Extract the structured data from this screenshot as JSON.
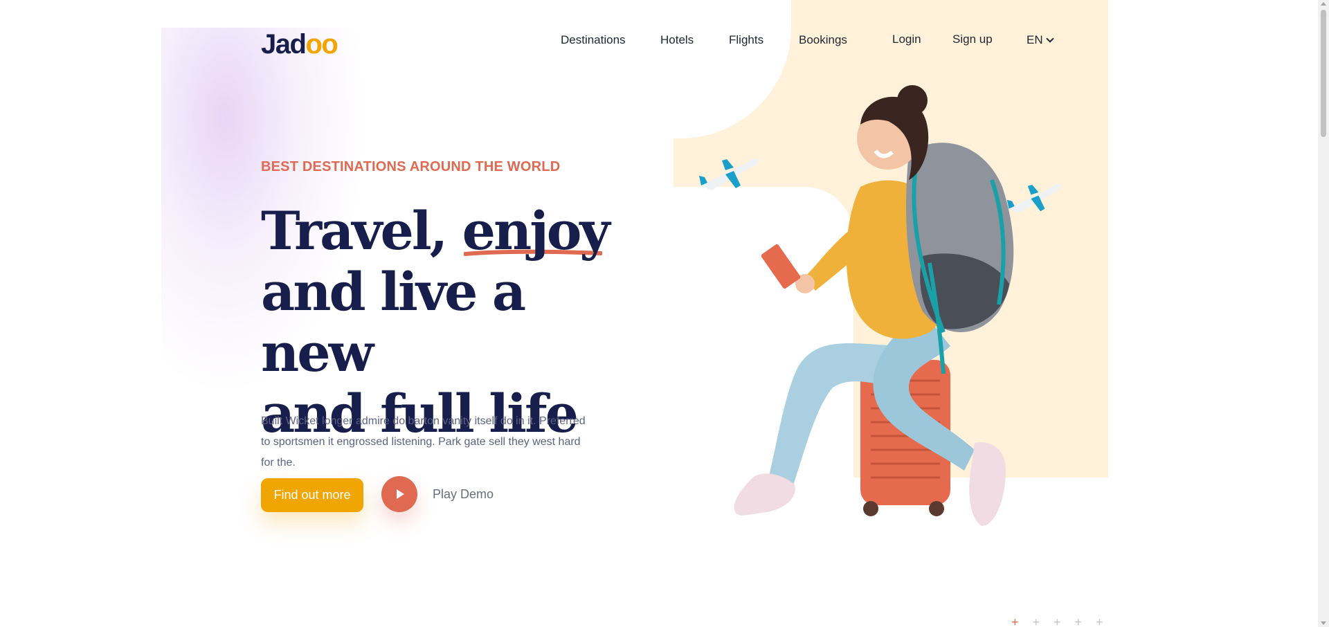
{
  "header": {
    "logo": "Jadoo",
    "nav": [
      "Destinations",
      "Hotels",
      "Flights",
      "Bookings"
    ],
    "login": "Login",
    "signup": "Sign up",
    "language": "EN"
  },
  "hero": {
    "tagline": "BEST DESTINATIONS AROUND THE WORLD",
    "headline_line1_a": "Travel,",
    "headline_line1_b": "enjoy",
    "headline_line2": "and live a new",
    "headline_line3": "and full life",
    "description": "Built Wicket longer admire do barton vanity itself do in it. Preferred to sportsmen it engrossed listening. Park gate sell they west hard for the.",
    "cta_label": "Find out more",
    "play_label": "Play Demo"
  },
  "icons": {
    "play": "play-icon",
    "chevron": "chevron-down-icon",
    "plane": "plane-icon"
  },
  "colors": {
    "navy": "#181e4b",
    "accent_orange": "#df6951",
    "cta_yellow": "#f1a501",
    "blob_cream": "#fff1da",
    "text_muted": "#5e6282"
  },
  "slider": {
    "dot_count": 5,
    "active_index": 0
  }
}
